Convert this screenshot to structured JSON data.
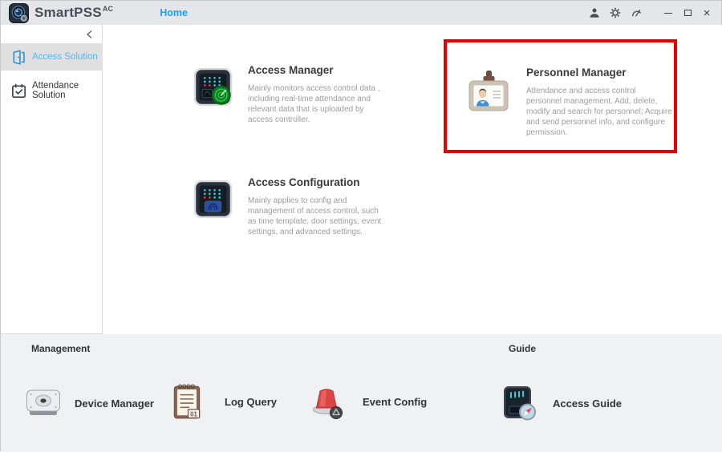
{
  "titlebar": {
    "app_name": "SmartPSS",
    "app_suffix": "AC",
    "tabs": [
      {
        "label": "Home"
      }
    ]
  },
  "sidebar": {
    "items": [
      {
        "label": "Access Solution",
        "icon": "door-icon",
        "active": true
      },
      {
        "label": "Attendance Solution",
        "icon": "calendar-check-icon",
        "active": false
      }
    ]
  },
  "main": {
    "cards": [
      {
        "id": "access-manager",
        "title": "Access Manager",
        "description": "Mainly monitors access control data , including real-time attendance and relevant data that is uploaded by access controller.",
        "icon": "access-controller-radar-icon",
        "highlighted": false
      },
      {
        "id": "personnel-manager",
        "title": "Personnel Manager",
        "description": "Attendance and access control personnel management.  Add, delete, modify and search for personnel; Acquire and send personnel info, and configure permission.",
        "icon": "id-badge-icon",
        "highlighted": true
      },
      {
        "id": "access-configuration",
        "title": "Access Configuration",
        "description": "Mainly applies to config and management of access control, such as time template, door settings, event settings, and advanced settings.",
        "icon": "access-controller-fingerprint-icon",
        "highlighted": false
      }
    ]
  },
  "footer": {
    "log_badge": "01",
    "sections": [
      {
        "title": "Management",
        "items": [
          {
            "label": "Device Manager",
            "icon": "hard-drive-icon"
          },
          {
            "label": "Log Query",
            "icon": "notepad-icon"
          },
          {
            "label": "Event Config",
            "icon": "siren-icon"
          }
        ]
      },
      {
        "title": "Guide",
        "items": [
          {
            "label": "Access Guide",
            "icon": "controller-compass-icon"
          }
        ]
      }
    ]
  },
  "icons": {
    "titlebar_right": [
      "user-icon",
      "gear-icon",
      "gauge-icon",
      "minimize-icon",
      "maximize-icon",
      "close-icon"
    ],
    "sidebar_collapse": "chevron-left-icon"
  },
  "colors": {
    "accent_blue": "#1e9ff2",
    "sidebar_active_blue": "#5cb4ef",
    "highlight_red": "#e60000",
    "titlebar_bg": "#e4e6e9",
    "footer_bg": "#f0f1f3"
  }
}
